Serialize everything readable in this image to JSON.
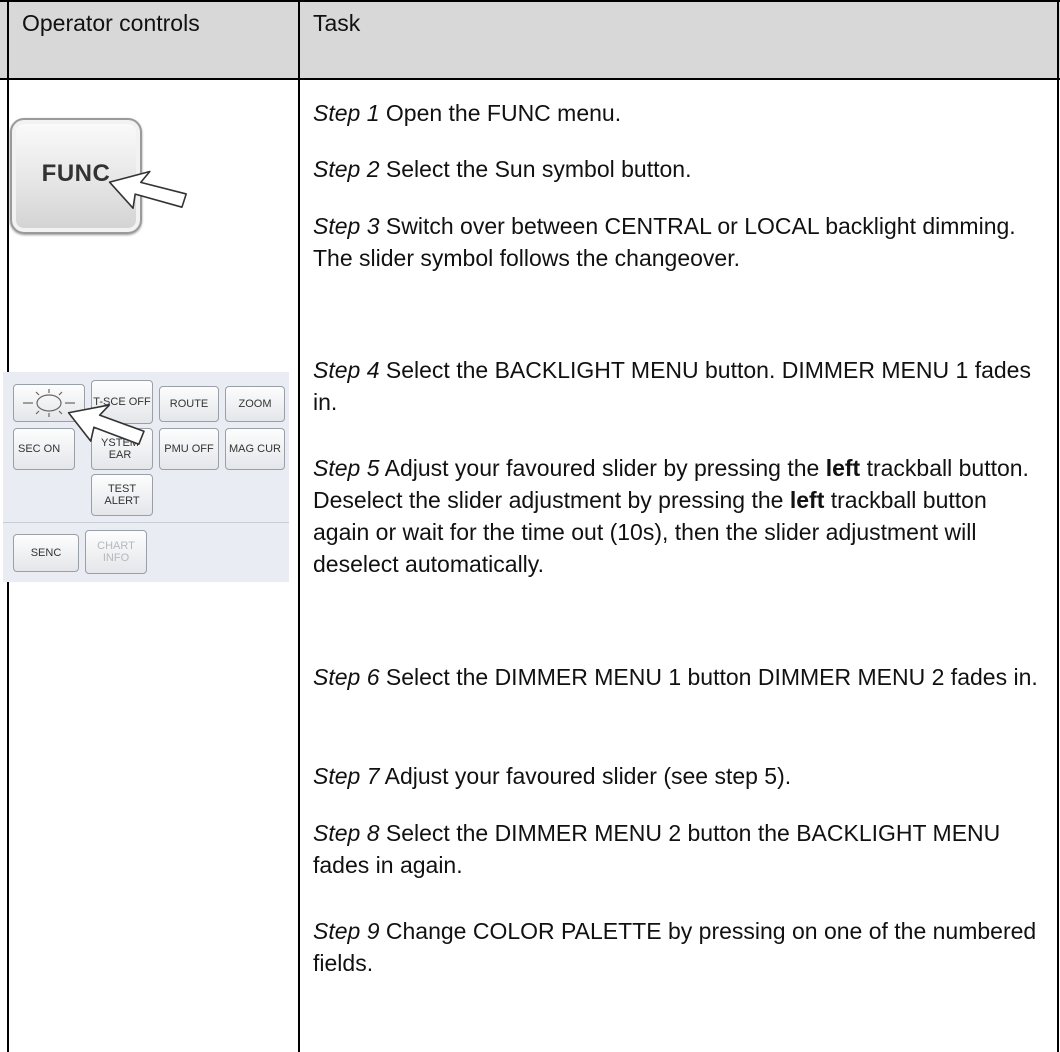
{
  "header": {
    "col1": "Operator controls",
    "col2": "Task"
  },
  "func_button": {
    "label": "FUNC",
    "icon": "cursor-arrow-icon"
  },
  "panel": {
    "buttons": [
      {
        "id": "sun",
        "label": ""
      },
      {
        "id": "tsce",
        "label": "T-SCE OFF"
      },
      {
        "id": "route",
        "label": "ROUTE"
      },
      {
        "id": "zoom",
        "label": "ZOOM"
      },
      {
        "id": "sec",
        "label": "SEC ON"
      },
      {
        "id": "system",
        "label": "YSTEM EAR"
      },
      {
        "id": "pmu",
        "label": "PMU OFF"
      },
      {
        "id": "mag",
        "label": "MAG CUR"
      },
      {
        "id": "test",
        "label": "TEST ALERT"
      },
      {
        "id": "senc",
        "label": "SENC"
      },
      {
        "id": "chart",
        "label": "CHART INFO"
      }
    ]
  },
  "steps": [
    {
      "label": "Step 1",
      "segments": [
        {
          "t": " Open the FUNC menu."
        }
      ]
    },
    {
      "label": "Step 2",
      "segments": [
        {
          "t": " Select the Sun symbol button."
        }
      ]
    },
    {
      "label": "Step 3",
      "segments": [
        {
          "t": " Switch over between CENTRAL or LOCAL backlight dimming. The slider symbol follows the changeover."
        }
      ]
    },
    {
      "label": "Step 4",
      "segments": [
        {
          "t": " Select the BACKLIGHT MENU button. DIMMER MENU 1 fades in."
        }
      ]
    },
    {
      "label": "Step 5",
      "segments": [
        {
          "t": " Adjust your favoured slider by pressing the "
        },
        {
          "t": "left",
          "b": true
        },
        {
          "t": " trackball button. Deselect the slider adjustment by pressing the "
        },
        {
          "t": "left",
          "b": true
        },
        {
          "t": " trackball button again or wait for the time out (10s), then the slider adjustment will deselect automatically."
        }
      ]
    },
    {
      "label": "Step 6",
      "segments": [
        {
          "t": " Select the DIMMER MENU 1 button DIMMER MENU 2 fades in."
        }
      ]
    },
    {
      "label": "Step 7",
      "segments": [
        {
          "t": " Adjust your favoured slider (see step 5)."
        }
      ]
    },
    {
      "label": "Step 8",
      "segments": [
        {
          "t": " Select the DIMMER MENU 2 button the BACKLIGHT MENU fades in again."
        }
      ]
    },
    {
      "label": "Step 9",
      "segments": [
        {
          "t": " Change COLOR PALETTE by pressing on one of the numbered fields."
        }
      ]
    }
  ]
}
